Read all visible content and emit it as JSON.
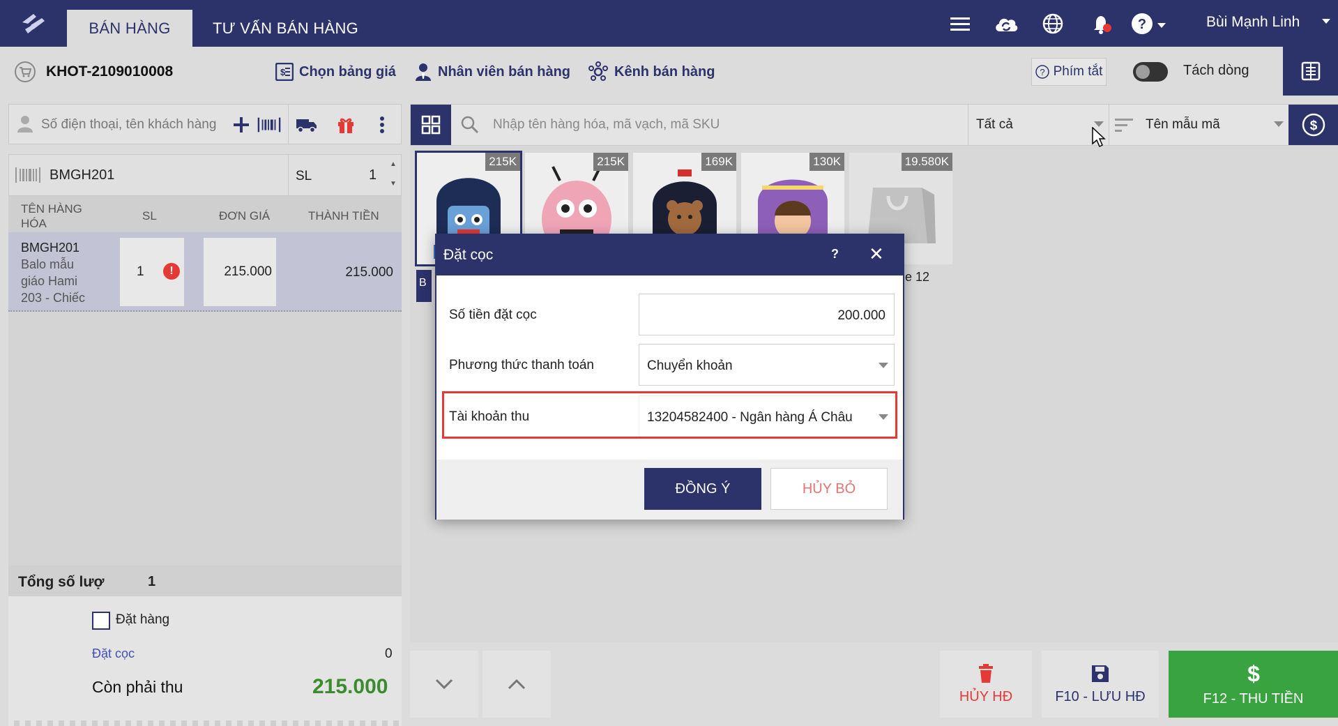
{
  "header": {
    "tabs": [
      {
        "label": "BÁN HÀNG",
        "active": true
      },
      {
        "label": "TƯ VẤN BÁN HÀNG",
        "active": false
      }
    ],
    "user_name": "Bùi Mạnh Linh",
    "icons": [
      "menu-icon",
      "cloud-sync-icon",
      "globe-icon",
      "notification-bell-icon",
      "help-icon"
    ]
  },
  "toolbar": {
    "invoice_code": "KHOT-2109010008",
    "price_list_label": "Chọn bảng giá",
    "staff_label": "Nhân viên bán hàng",
    "channel_label": "Kênh bán hàng",
    "shortcut_label": "Phím tắt",
    "split_line_label": "Tách dòng"
  },
  "cart": {
    "customer_placeholder": "Số điện thoại, tên khách hàng",
    "sku_value": "BMGH201",
    "qty_label": "SL",
    "qty_value": "1",
    "columns": [
      "TÊN HÀNG HÓA",
      "SL",
      "ĐƠN GIÁ",
      "THÀNH TIỀN"
    ],
    "rows": [
      {
        "code": "BMGH201",
        "name": "Balo mẫu giáo Hami 203 - Chiếc",
        "qty": "1",
        "unit_price": "215.000",
        "total": "215.000"
      }
    ],
    "total_qty_label": "Tổng số lượ",
    "total_qty": "1",
    "order_label": "Đặt hàng",
    "deposit_label": "Đặt cọc",
    "deposit_value": "0",
    "remaining_label": "Còn phải thu",
    "remaining_value": "215.000"
  },
  "products": {
    "search_placeholder": "Nhập tên hàng hóa, mã vạch, mã SKU",
    "filter_category": "Tất cả",
    "filter_sort": "Tên mẫu mã",
    "items": [
      {
        "price": "215K"
      },
      {
        "price": "215K"
      },
      {
        "price": "169K"
      },
      {
        "price": "130K"
      },
      {
        "price": "19.580K"
      }
    ],
    "caption_partial": "e 12",
    "strip_partial": "B"
  },
  "actions": {
    "cancel_label": "HỦY HĐ",
    "save_label": "F10 - LƯU HĐ",
    "pay_label": "F12 - THU TIỀN"
  },
  "modal": {
    "title": "Đặt cọc",
    "help": "?",
    "close": "✕",
    "amount_label": "Số tiền đặt cọc",
    "amount_value": "200.000",
    "method_label": "Phương thức thanh toán",
    "method_value": "Chuyển khoản",
    "account_label": "Tài khoản thu",
    "account_value": "13204582400 - Ngân hàng Á Châu",
    "ok_label": "ĐỒNG Ý",
    "cancel_label": "HỦY BỎ"
  },
  "colors": {
    "primary": "#2c326a",
    "success": "#38a33f",
    "danger": "#e53935",
    "highlight": "#e53935"
  }
}
